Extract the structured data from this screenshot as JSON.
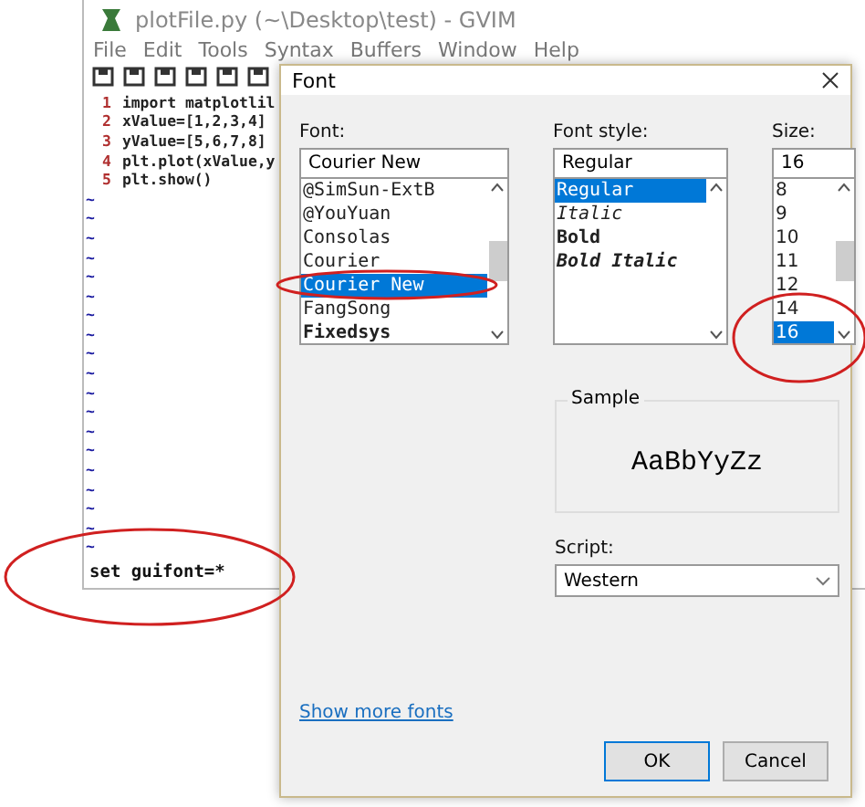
{
  "editor": {
    "title": "plotFile.py (~\\Desktop\\test) - GVIM",
    "menu": [
      "File",
      "Edit",
      "Tools",
      "Syntax",
      "Buffers",
      "Window",
      "Help"
    ],
    "lines": [
      {
        "number": "1",
        "text": "import matplotlil"
      },
      {
        "number": "2",
        "text": "xValue=[1,2,3,4]"
      },
      {
        "number": "3",
        "text": "yValue=[5,6,7,8]"
      },
      {
        "number": "4",
        "text": "plt.plot(xValue,y"
      },
      {
        "number": "5",
        "text": "plt.show()"
      }
    ],
    "tildes": [
      "~",
      "~",
      "~",
      "~",
      "~",
      "~",
      "~",
      "~",
      "~",
      "~",
      "~",
      "~",
      "~",
      "~",
      "~",
      "~",
      "~",
      "~",
      "~"
    ],
    "command": "set guifont=*"
  },
  "dialog": {
    "title": "Font",
    "font": {
      "label": "Font:",
      "value": "Courier New",
      "items": [
        {
          "label": "@SimSun-ExtB",
          "selected": false
        },
        {
          "label": "@YouYuan",
          "selected": false
        },
        {
          "label": "Consolas",
          "selected": false
        },
        {
          "label": "Courier",
          "selected": false
        },
        {
          "label": "Courier New",
          "selected": true
        },
        {
          "label": "FangSong",
          "selected": false
        },
        {
          "label": "Fixedsys",
          "selected": false
        }
      ]
    },
    "style": {
      "label": "Font style:",
      "value": "Regular",
      "items": [
        {
          "label": "Regular",
          "selected": true
        },
        {
          "label": "Italic",
          "selected": false
        },
        {
          "label": "Bold",
          "selected": false
        },
        {
          "label": "Bold Italic",
          "selected": false
        }
      ]
    },
    "size": {
      "label": "Size:",
      "value": "16",
      "items": [
        {
          "label": "8",
          "selected": false
        },
        {
          "label": "9",
          "selected": false
        },
        {
          "label": "10",
          "selected": false
        },
        {
          "label": "11",
          "selected": false
        },
        {
          "label": "12",
          "selected": false
        },
        {
          "label": "14",
          "selected": false
        },
        {
          "label": "16",
          "selected": true
        }
      ]
    },
    "sample": {
      "label": "Sample",
      "text": "AaBbYyZz"
    },
    "script": {
      "label": "Script:",
      "value": "Western"
    },
    "link": "Show more fonts",
    "buttons": [
      "OK",
      "Cancel"
    ]
  }
}
